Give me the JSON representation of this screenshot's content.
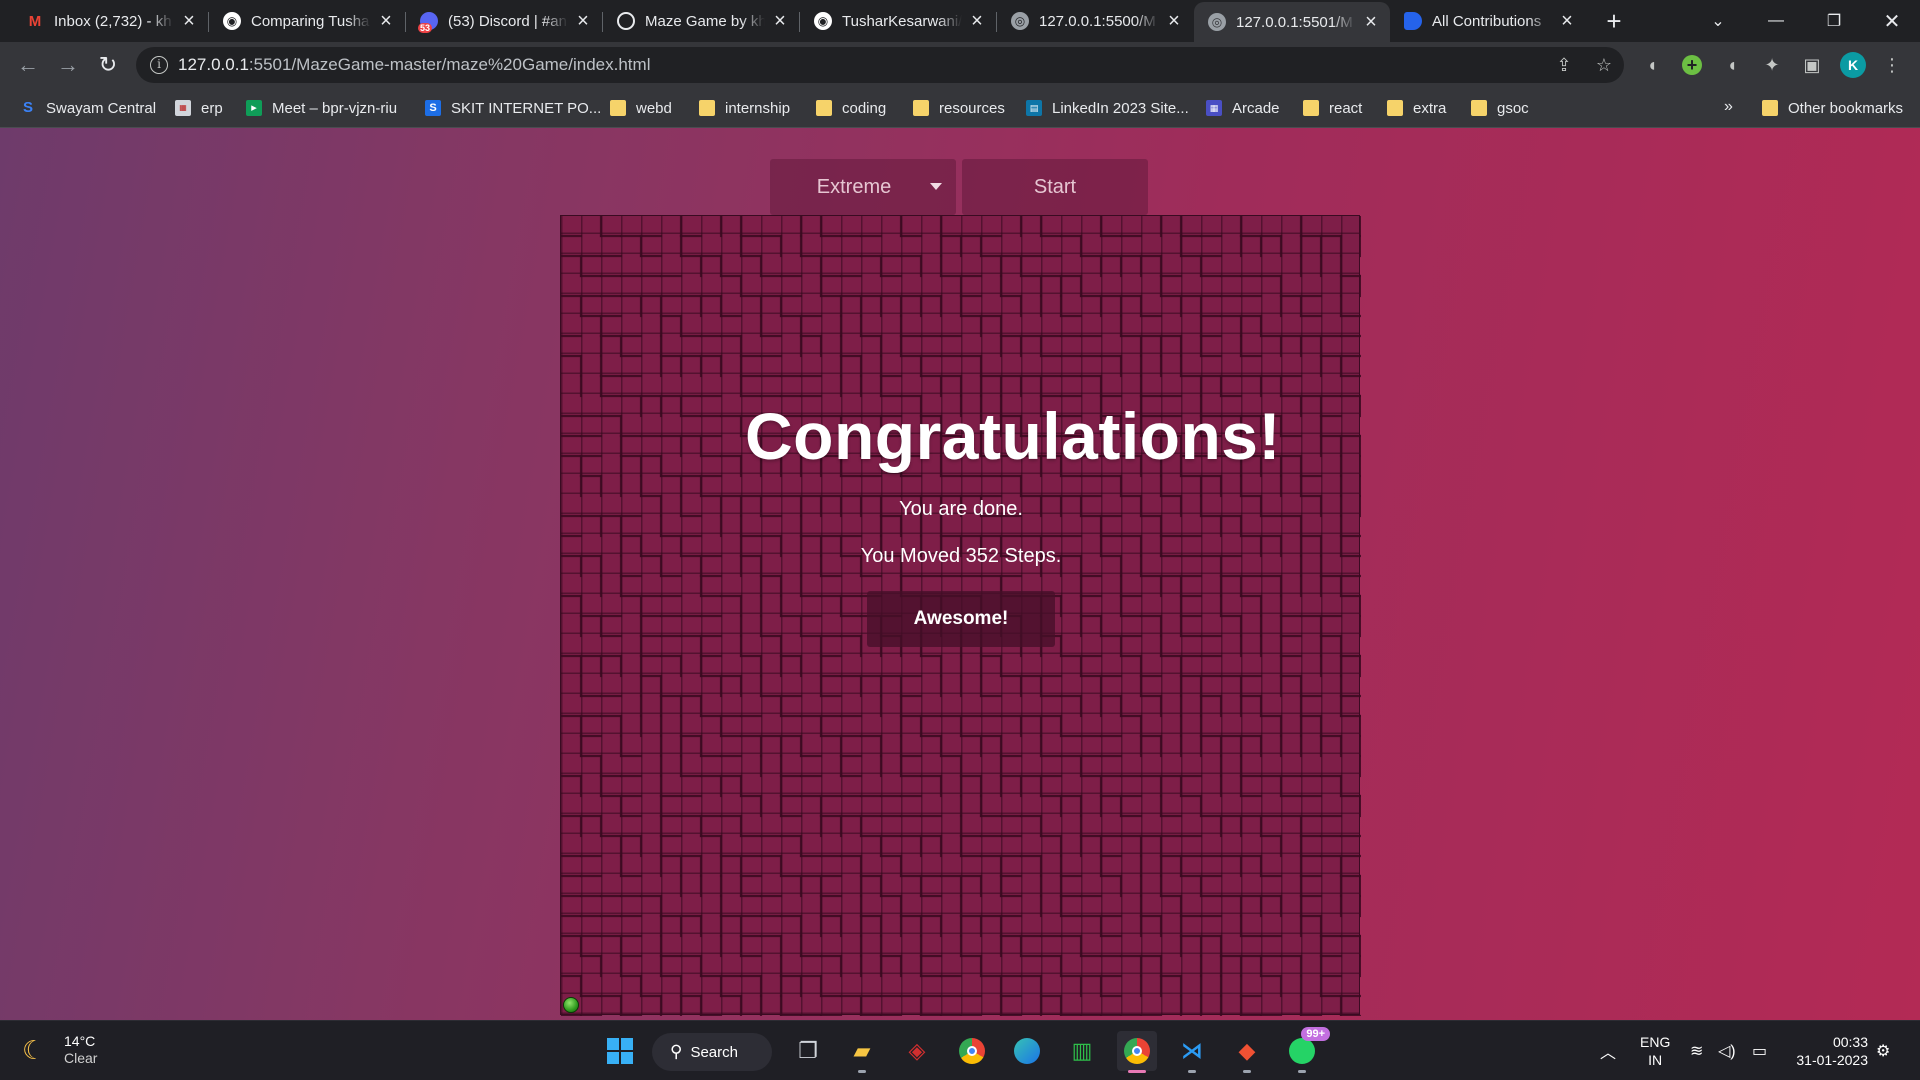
{
  "browser": {
    "tabs": [
      {
        "title": "Inbox (2,732) - kh",
        "icon": "gmail-icon"
      },
      {
        "title": "Comparing Tusha",
        "icon": "github-icon"
      },
      {
        "title": "(53) Discord | #an",
        "icon": "discord-icon",
        "badge": "53"
      },
      {
        "title": "Maze Game by kh",
        "icon": "glitch-icon"
      },
      {
        "title": "TusharKesarwani/",
        "icon": "github-icon"
      },
      {
        "title": "127.0.0.1:5500/M",
        "icon": "globe-icon"
      },
      {
        "title": "127.0.0.1:5501/M",
        "icon": "globe-icon",
        "active": true
      },
      {
        "title": "All Contributions",
        "icon": "bookmark-blue-icon"
      }
    ],
    "new_tab": "+",
    "address": {
      "host": "127.0.0.1",
      "rest": ":5501/MazeGame-master/maze%20Game/index.html"
    },
    "profile_initial": "K",
    "bookmarks": [
      {
        "label": "Swayam Central",
        "icon": "swayam-icon"
      },
      {
        "label": "erp",
        "icon": "erp-icon"
      },
      {
        "label": "Meet – bpr-vjzn-riu",
        "icon": "meet-icon"
      },
      {
        "label": "SKIT INTERNET PO...",
        "icon": "skit-icon"
      },
      {
        "label": "webd",
        "icon": "folder-icon"
      },
      {
        "label": "internship",
        "icon": "folder-icon"
      },
      {
        "label": "coding",
        "icon": "folder-icon"
      },
      {
        "label": "resources",
        "icon": "folder-icon"
      },
      {
        "label": "LinkedIn 2023 Site...",
        "icon": "linkedin-icon"
      },
      {
        "label": "Arcade",
        "icon": "arcade-icon"
      },
      {
        "label": "react",
        "icon": "folder-icon"
      },
      {
        "label": "extra",
        "icon": "folder-icon"
      },
      {
        "label": "gsoc",
        "icon": "folder-icon"
      }
    ],
    "bookmarks_more": "»",
    "other_bookmarks": "Other bookmarks"
  },
  "game": {
    "difficulty": "Extreme",
    "start_label": "Start",
    "congrats_title": "Congratulations!",
    "done_text": "You are done.",
    "steps_text": "You Moved 352 Steps.",
    "awesome_label": "Awesome!"
  },
  "taskbar": {
    "weather_temp": "14°C",
    "weather_desc": "Clear",
    "search_label": "Search",
    "whatsapp_badge": "99+",
    "lang_line1": "ENG",
    "lang_line2": "IN",
    "time": "00:33",
    "date": "31-01-2023"
  },
  "colors": {
    "page_gradient_start": "#6e3b6b",
    "page_gradient_end": "#b32a55",
    "maze_fill": "#7e1e48",
    "ball": "#2f9a1e"
  }
}
